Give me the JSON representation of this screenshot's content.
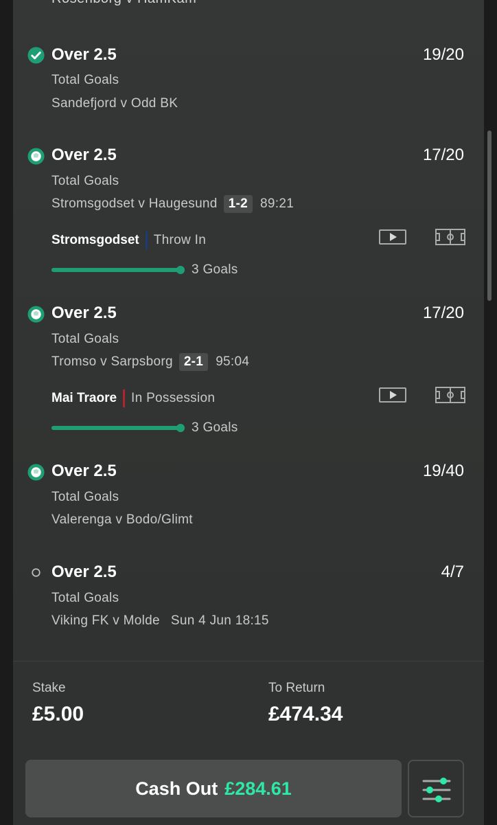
{
  "top_partial_event": "Rosenborg v HamKam",
  "legs": [
    {
      "status_icon": "check-circle-icon",
      "selection": "Over 2.5",
      "odds": "19/20",
      "market": "Total Goals",
      "event": "Sandefjord v Odd BK"
    },
    {
      "status_icon": "football-live-icon",
      "selection": "Over 2.5",
      "odds": "17/20",
      "market": "Total Goals",
      "event": "Stromsgodset v Haugesund",
      "score": "1-2",
      "clock": "89:21",
      "live_team": "Stromsgodset",
      "live_team_color": "#1c3b78",
      "live_state": "Throw In",
      "progress_label": "3 Goals",
      "progress": 1.0
    },
    {
      "status_icon": "football-live-icon",
      "selection": "Over 2.5",
      "odds": "17/20",
      "market": "Total Goals",
      "event": "Tromso v Sarpsborg",
      "score": "2-1",
      "clock": "95:04",
      "live_team": "Mai Traore",
      "live_team_color": "#b3242c",
      "live_state": "In Possession",
      "progress_label": "3 Goals",
      "progress": 1.0
    },
    {
      "status_icon": "football-live-icon",
      "selection": "Over 2.5",
      "odds": "19/40",
      "market": "Total Goals",
      "event": "Valerenga v Bodo/Glimt"
    },
    {
      "status_icon": "pending-circle-icon",
      "selection": "Over 2.5",
      "odds": "4/7",
      "market": "Total Goals",
      "event": "Viking FK v Molde",
      "kickoff": "Sun 4 Jun 18:15"
    }
  ],
  "footer": {
    "stake_label": "Stake",
    "stake_value": "£5.00",
    "return_label": "To Return",
    "return_value": "£474.34",
    "cashout_label": "Cash Out",
    "cashout_amount": "£284.61"
  },
  "colors": {
    "accent_green": "#1f9e75",
    "cashout_green": "#2ee8a6"
  }
}
